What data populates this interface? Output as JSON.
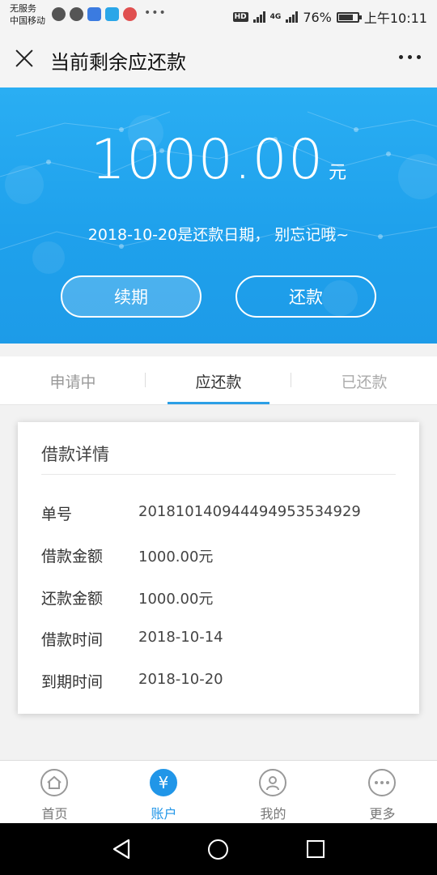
{
  "status_bar": {
    "carrier_line1": "无服务",
    "carrier_line2": "中国移动",
    "notification_icons": [
      "chat-bubble-icon",
      "shield-icon",
      "app-badge-icon",
      "send-icon",
      "location-icon"
    ],
    "hd": "HD",
    "network": "4G",
    "battery": "76%",
    "time": "上午10:11"
  },
  "title_bar": {
    "title": "当前剩余应还款"
  },
  "hero": {
    "amount": "1000.00",
    "unit": "元",
    "due_note": "2018-10-20是还款日期，  别忘记哦~",
    "renew_label": "续期",
    "repay_label": "还款",
    "bg_color": "#1fa1ec"
  },
  "tabs": [
    {
      "label": "申请中"
    },
    {
      "label": "应还款"
    },
    {
      "label": "已还款"
    }
  ],
  "active_tab": "应还款",
  "loan_detail": {
    "title": "借款详情",
    "rows": [
      {
        "label": "单号",
        "value": "20181014094449495353 4929"
      },
      {
        "label": "借款金额",
        "value": "1000.00元"
      },
      {
        "label": "还款金额",
        "value": "1000.00元"
      },
      {
        "label": "借款时间",
        "value": "2018-10-14"
      },
      {
        "label": "到期时间",
        "value": "2018-10-20"
      }
    ]
  },
  "bottom_nav": [
    {
      "label": "首页",
      "icon": "home-icon"
    },
    {
      "label": "账户",
      "icon": "yuan-icon",
      "glyph": "¥"
    },
    {
      "label": "我的",
      "icon": "person-icon"
    },
    {
      "label": "更多",
      "icon": "more-icon"
    }
  ],
  "accent_color": "#2196e8"
}
